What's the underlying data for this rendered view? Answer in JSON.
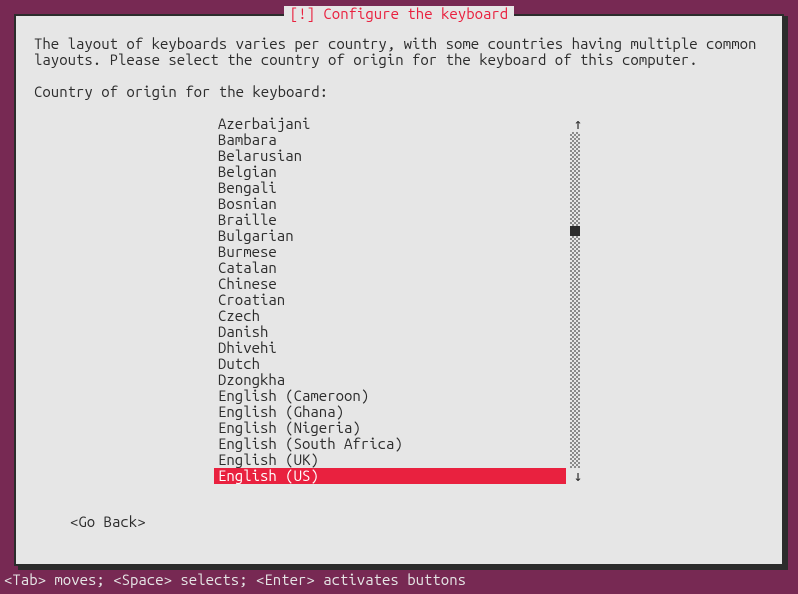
{
  "title": "[!] Configure the keyboard",
  "body": "The layout of keyboards varies per country, with some countries having multiple common layouts. Please select the country of origin for the keyboard of this computer.",
  "prompt": "Country of origin for the keyboard:",
  "items": [
    "Azerbaijani",
    "Bambara",
    "Belarusian",
    "Belgian",
    "Bengali",
    "Bosnian",
    "Braille",
    "Bulgarian",
    "Burmese",
    "Catalan",
    "Chinese",
    "Croatian",
    "Czech",
    "Danish",
    "Dhivehi",
    "Dutch",
    "Dzongkha",
    "English (Cameroon)",
    "English (Ghana)",
    "English (Nigeria)",
    "English (South Africa)",
    "English (UK)",
    "English (US)"
  ],
  "selected_index": 22,
  "goback": "<Go Back>",
  "footer": "<Tab> moves; <Space> selects; <Enter> activates buttons",
  "arrows": {
    "up": "↑",
    "down": "↓"
  }
}
